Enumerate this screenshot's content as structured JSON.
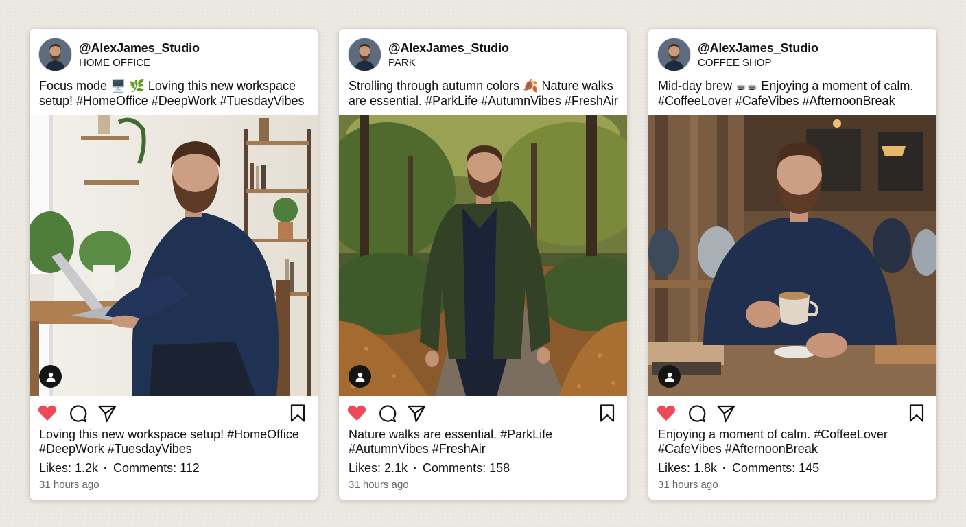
{
  "posts": [
    {
      "username": "@AlexJames_Studio",
      "location": "HOME OFFICE",
      "caption_top": "Focus mode 🖥️ 🌿 Loving this new workspace setup! #HomeOffice #DeepWork #TuesdayVibes",
      "caption_bottom": "Loving this new workspace setup! #HomeOffice #DeepWork #TuesdayVibes",
      "likes": "Likes: 1.2k",
      "comments": "Comments: 112",
      "time": "31 hours ago",
      "scene": "home-office"
    },
    {
      "username": "@AlexJames_Studio",
      "location": "PARK",
      "caption_top": "Strolling through autumn colors 🍂 Nature walks are essential. #ParkLife #AutumnVibes #FreshAir",
      "caption_bottom": "Nature walks are essential. #ParkLife #AutumnVibes #FreshAir",
      "likes": "Likes: 2.1k",
      "comments": "Comments: 158",
      "time": "31 hours ago",
      "scene": "park"
    },
    {
      "username": "@AlexJames_Studio",
      "location": "COFFEE SHOP",
      "caption_top": "Mid-day brew ☕☕ Enjoying a moment of calm. #CoffeeLover #CafeVibes #AfternoonBreak",
      "caption_bottom": "Enjoying a moment of calm. #CoffeeLover #CafeVibes #AfternoonBreak",
      "likes": "Likes: 1.8k",
      "comments": "Comments: 145",
      "time": "31 hours ago",
      "scene": "coffee-shop"
    }
  ],
  "icons": {
    "like": "heart-icon",
    "comment": "comment-bubble-icon",
    "share": "paper-plane-icon",
    "save": "bookmark-icon",
    "tag": "person-tag-icon"
  },
  "colors": {
    "like": "#ed4956",
    "background": "#ebe8e1",
    "card": "#ffffff",
    "muted_text": "#666666"
  }
}
